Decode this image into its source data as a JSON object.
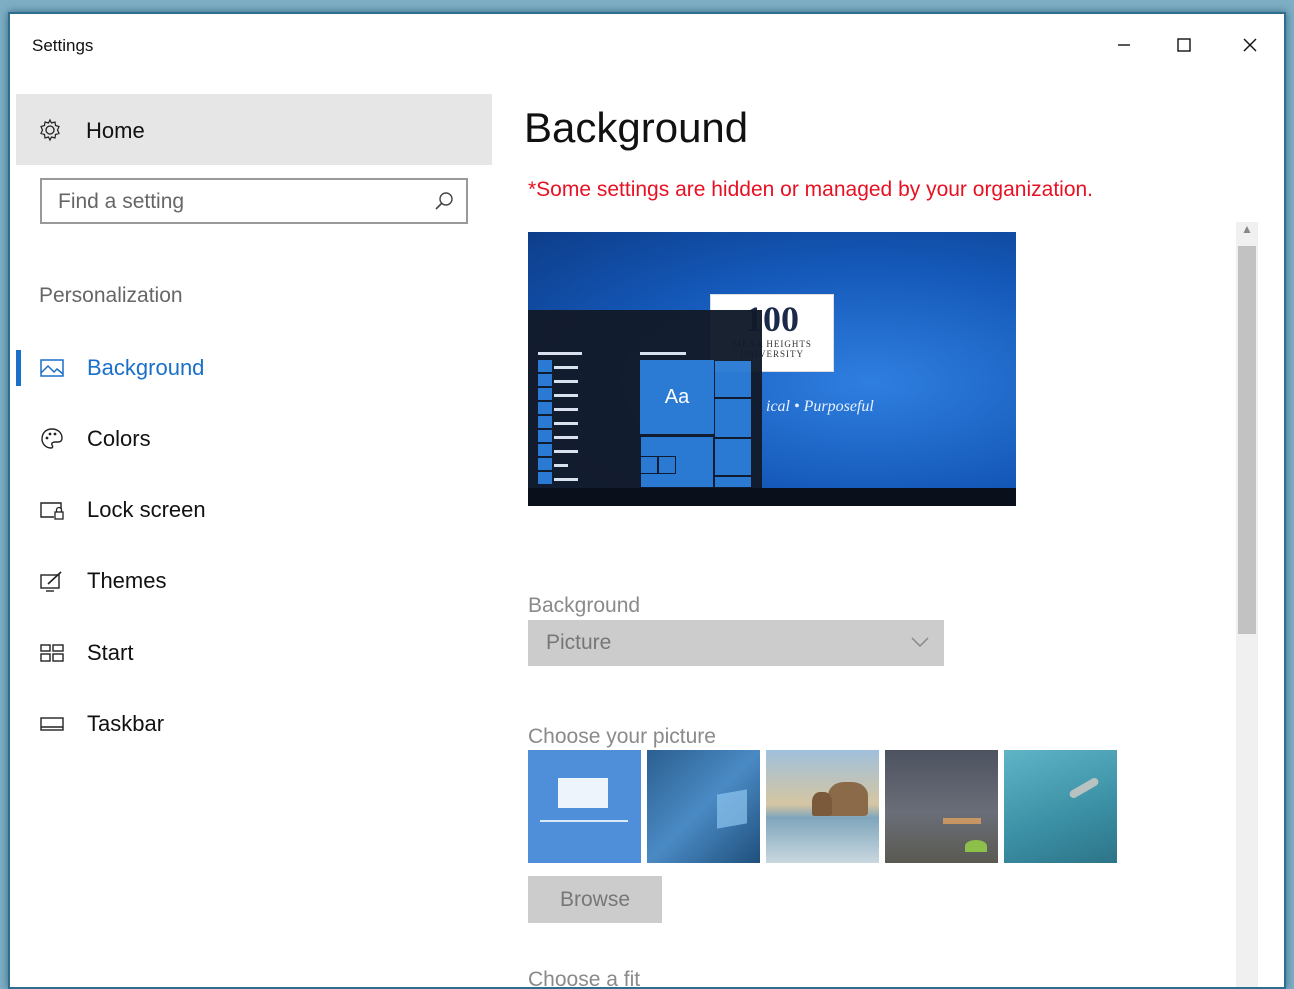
{
  "window": {
    "title": "Settings",
    "minimize_glyph": "—",
    "maximize_glyph": "☐",
    "close_glyph": "✕"
  },
  "sidebar": {
    "home_label": "Home",
    "home_icon": "gear-icon",
    "search_placeholder": "Find a setting",
    "search_icon": "search-icon",
    "section_label": "Personalization",
    "items": [
      {
        "label": "Background",
        "icon": "picture-icon",
        "active": true
      },
      {
        "label": "Colors",
        "icon": "palette-icon",
        "active": false
      },
      {
        "label": "Lock screen",
        "icon": "lock-screen-icon",
        "active": false
      },
      {
        "label": "Themes",
        "icon": "themes-icon",
        "active": false
      },
      {
        "label": "Start",
        "icon": "start-icon",
        "active": false
      },
      {
        "label": "Taskbar",
        "icon": "taskbar-icon",
        "active": false
      }
    ]
  },
  "main": {
    "heading": "Background",
    "org_warning": "*Some settings are hidden or managed by your organization.",
    "preview": {
      "logo_number": "100",
      "logo_name": "SIENA HEIGHTS",
      "logo_sub": "UNIVERSITY",
      "tagline": "ical • Purposeful",
      "tile_label": "Aa"
    },
    "background_label": "Background",
    "background_value": "Picture",
    "choose_picture_label": "Choose your picture",
    "thumbnails": [
      "siena-heights-logo",
      "windows-hero",
      "beach-rocks",
      "night-sky-tent",
      "underwater-swimmer"
    ],
    "browse_label": "Browse",
    "choose_fit_label": "Choose a fit"
  },
  "colors": {
    "accent": "#1a6fc8",
    "warning": "#e81123",
    "disabled_bg": "#cccccc",
    "disabled_text": "#777777"
  }
}
